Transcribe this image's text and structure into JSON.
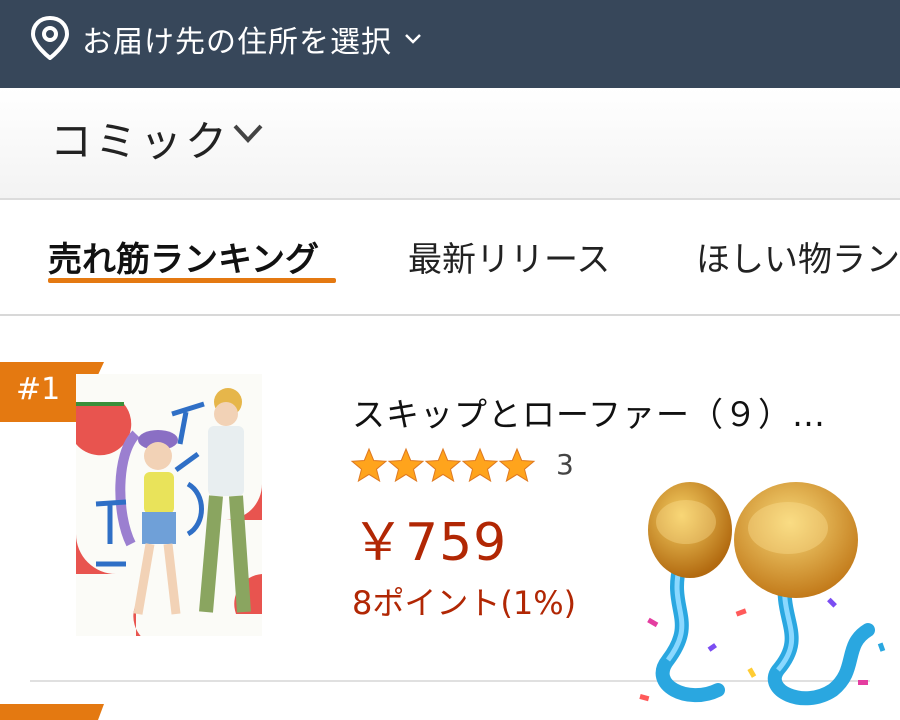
{
  "address_bar": {
    "label": "お届け先の住所を選択",
    "pin_icon": "location-pin-icon",
    "chevron_icon": "chevron-down-icon",
    "bg_color": "#37475a"
  },
  "category": {
    "label": "コミック",
    "chevron_icon": "chevron-down-icon"
  },
  "tabs": [
    {
      "label": "売れ筋ランキング",
      "active": true
    },
    {
      "label": "最新リリース",
      "active": false
    },
    {
      "label": "ほしい物ランキング",
      "active": false
    }
  ],
  "accent_color": "#e47911",
  "product": {
    "rank": "#1",
    "title": "スキップとローファー（９）…",
    "rating": 5,
    "review_count": "3",
    "price": "￥759",
    "points": "8ポイント(1%)",
    "price_color": "#b12704",
    "star_color": "#ffa41c"
  },
  "sticker": {
    "icon": "mushroom-confetti-sticker"
  }
}
